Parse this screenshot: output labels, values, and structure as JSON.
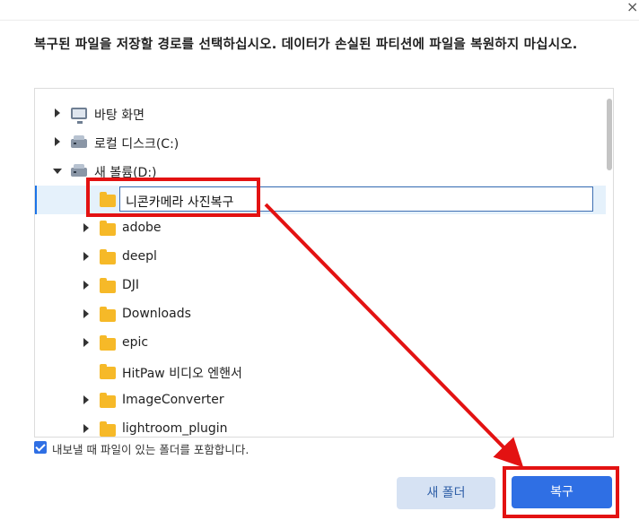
{
  "dialog": {
    "close_glyph": "×",
    "description": "복구된 파일을 저장할 경로를 선택하십시오. 데이터가 손실된 파티션에 파일을 복원하지 마십시오.",
    "include_folder_label": "내보낼 때 파일이 있는 폴더를 포함합니다.",
    "include_folder_checked": true
  },
  "tree": {
    "items": [
      {
        "label": "바탕 화면",
        "icon": "desktop-icon",
        "expand": "collapsed"
      },
      {
        "label": "로컬 디스크(C:)",
        "icon": "drive-icon",
        "expand": "collapsed"
      },
      {
        "label": "새 볼륨(D:)",
        "icon": "drive-icon",
        "expand": "expanded"
      },
      {
        "label": "니콘카메라 사진복구",
        "icon": "folder-icon",
        "expand": "none",
        "editing": true
      },
      {
        "label": "adobe",
        "icon": "folder-icon",
        "expand": "collapsed"
      },
      {
        "label": "deepl",
        "icon": "folder-icon",
        "expand": "collapsed"
      },
      {
        "label": "DJI",
        "icon": "folder-icon",
        "expand": "collapsed"
      },
      {
        "label": "Downloads",
        "icon": "folder-icon",
        "expand": "collapsed"
      },
      {
        "label": "epic",
        "icon": "folder-icon",
        "expand": "collapsed"
      },
      {
        "label": "HitPaw 비디오 엔핸서",
        "icon": "folder-icon",
        "expand": "none"
      },
      {
        "label": "ImageConverter",
        "icon": "folder-icon",
        "expand": "collapsed"
      },
      {
        "label": "lightroom_plugin",
        "icon": "folder-icon",
        "expand": "collapsed"
      }
    ]
  },
  "buttons": {
    "new_folder": "새 폴더",
    "restore": "복구"
  },
  "colors": {
    "accent": "#2f6fe4",
    "highlight_red": "#e31212",
    "folder": "#f6b928"
  }
}
